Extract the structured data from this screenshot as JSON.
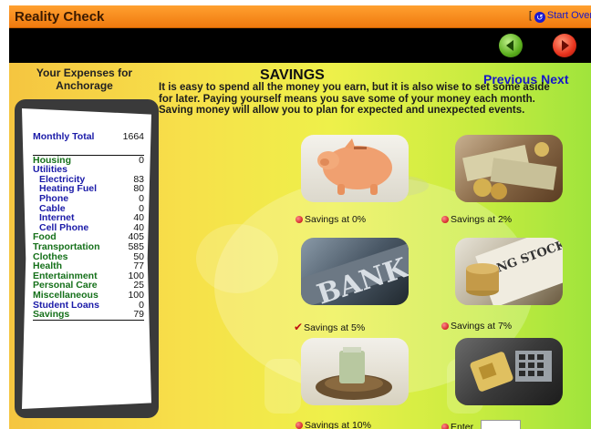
{
  "app": {
    "title": "Reality Check",
    "start_over": "Start Over",
    "start_over_bracket": "["
  },
  "colors": {
    "titlebar": "#f5871f",
    "navbar": "#000000",
    "back_button": "#5caf1e",
    "forward_button": "#e8321c",
    "link_blue": "#1616c8",
    "category_green": "#15701a"
  },
  "expenses": {
    "title": "Your Expenses for Anchorage",
    "monthly_total_label": "Monthly Total",
    "monthly_total_value": "1664",
    "rows": [
      {
        "label": "Housing",
        "value": "0",
        "kind": "cat-green"
      },
      {
        "label": "Utilities",
        "value": "",
        "kind": "cat-blue"
      },
      {
        "label": "Electricity",
        "value": "83",
        "kind": "sub"
      },
      {
        "label": "Heating Fuel",
        "value": "80",
        "kind": "sub"
      },
      {
        "label": "Phone",
        "value": "0",
        "kind": "sub"
      },
      {
        "label": "Cable",
        "value": "0",
        "kind": "sub"
      },
      {
        "label": "Internet",
        "value": "40",
        "kind": "sub"
      },
      {
        "label": "Cell Phone",
        "value": "40",
        "kind": "sub"
      },
      {
        "label": "Food",
        "value": "405",
        "kind": "cat-green"
      },
      {
        "label": "Transportation",
        "value": "585",
        "kind": "cat-green"
      },
      {
        "label": "Clothes",
        "value": "50",
        "kind": "cat-green"
      },
      {
        "label": "Health",
        "value": "77",
        "kind": "cat-green"
      },
      {
        "label": "Entertainment",
        "value": "100",
        "kind": "cat-green"
      },
      {
        "label": "Personal Care",
        "value": "25",
        "kind": "cat-green"
      },
      {
        "label": "Miscellaneous",
        "value": "100",
        "kind": "cat-green"
      },
      {
        "label": "Student Loans",
        "value": "0",
        "kind": "cat-blue"
      },
      {
        "label": "Savings",
        "value": "79",
        "kind": "cat-green"
      }
    ]
  },
  "savings": {
    "heading": "SAVINGS",
    "previous": "Previous",
    "next": "Next",
    "description": "It is easy to spend all the money you earn, but it is also wise to set some aside for later. Paying yourself means you save some of your money each month. Saving money will allow you to plan for expected and unexpected events.",
    "options": [
      {
        "label": "Savings at 0%",
        "image": "piggy-bank",
        "selected": false
      },
      {
        "label": "Savings at 2%",
        "image": "money-pile",
        "selected": false
      },
      {
        "label": "Savings at 5%",
        "image": "bank-sign",
        "selected": true
      },
      {
        "label": "Savings at 7%",
        "image": "coins-stock-page",
        "selected": false
      },
      {
        "label": "Savings at 10%",
        "image": "nest-egg-cash",
        "selected": false
      },
      {
        "label": "Enter",
        "image": "safe-keypad",
        "selected": false
      }
    ],
    "enter_value": ""
  }
}
